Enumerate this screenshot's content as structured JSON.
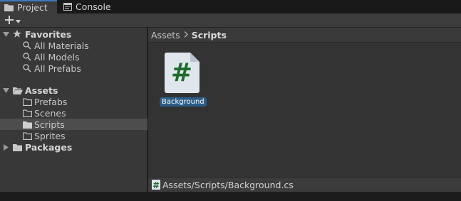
{
  "tabs": [
    {
      "label": "Project",
      "icon": "folder-icon",
      "active": true
    },
    {
      "label": "Console",
      "icon": "console-icon",
      "active": false
    }
  ],
  "toolbar": {
    "add_icon": "plus-icon",
    "dropdown_icon": "chevron-down-icon"
  },
  "sidebar": {
    "favorites": {
      "label": "Favorites",
      "items": [
        "All Materials",
        "All Models",
        "All Prefabs"
      ]
    },
    "assets": {
      "label": "Assets",
      "items": [
        "Prefabs",
        "Scenes",
        "Scripts",
        "Sprites"
      ],
      "selected": "Scripts"
    },
    "packages": {
      "label": "Packages"
    }
  },
  "breadcrumb": {
    "root": "Assets",
    "current": "Scripts"
  },
  "asset": {
    "name": "Background",
    "icon": "csharp-script-icon",
    "glyph": "#"
  },
  "status": {
    "path": "Assets/Scripts/Background.cs"
  },
  "colors": {
    "accent": "#3a79bb",
    "selection": "#2c5d87",
    "script_glyph": "#1f6b2b",
    "script_page": "#dfe6ee"
  }
}
